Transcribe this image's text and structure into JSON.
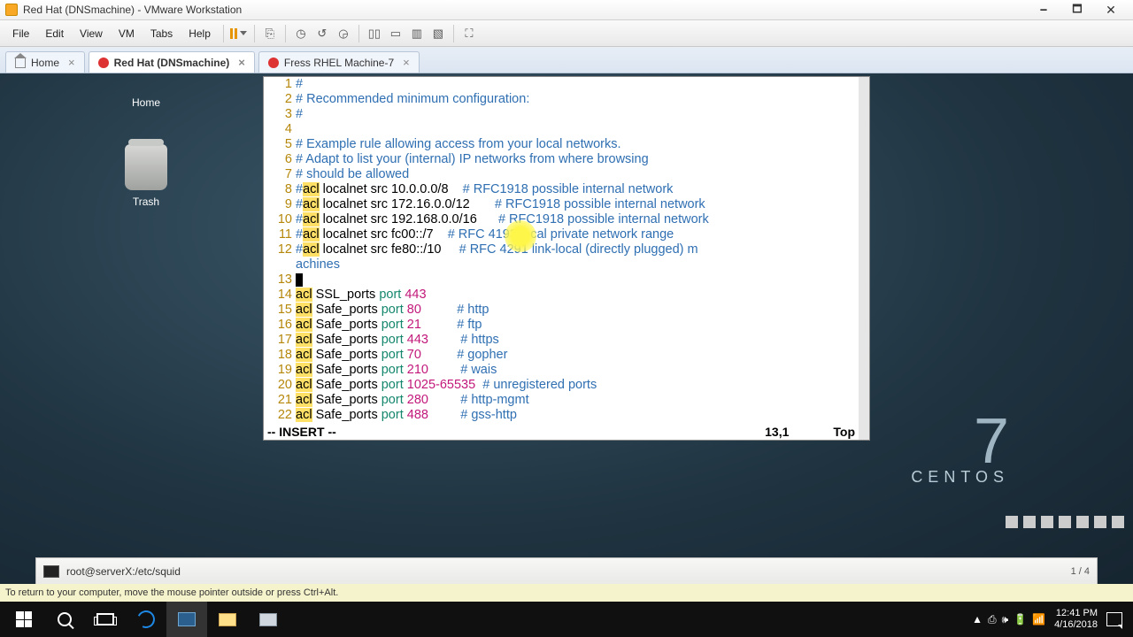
{
  "window": {
    "title": "Red Hat (DNSmachine) - VMware Workstation",
    "minimize": "🗕",
    "maximize": "🗖",
    "close": "✕"
  },
  "menu": {
    "file": "File",
    "edit": "Edit",
    "view": "View",
    "vm": "VM",
    "tabs": "Tabs",
    "help": "Help"
  },
  "tabs": {
    "home": "Home",
    "active": "Red Hat (DNSmachine)",
    "other": "Fress RHEL Machine-7"
  },
  "desktop": {
    "home": "Home",
    "trash": "Trash"
  },
  "centos": {
    "seven": "7",
    "label": "CENTOS"
  },
  "gnomebar": {
    "title": "root@serverX:/etc/squid",
    "pager": "1 / 4"
  },
  "hint": "To return to your computer, move the mouse pointer outside or press Ctrl+Alt.",
  "clock": {
    "time": "12:41 PM",
    "date": "4/16/2018"
  },
  "editor": {
    "mode": "-- INSERT --",
    "pos": "13,1",
    "loc": "Top",
    "lines": [
      {
        "n": "1",
        "text": [
          {
            "t": "#",
            "c": "c-comment"
          }
        ]
      },
      {
        "n": "2",
        "text": [
          {
            "t": "# Recommended minimum configuration:",
            "c": "c-comment"
          }
        ]
      },
      {
        "n": "3",
        "text": [
          {
            "t": "#",
            "c": "c-comment"
          }
        ]
      },
      {
        "n": "4",
        "text": [
          {
            "t": "",
            "c": ""
          }
        ]
      },
      {
        "n": "5",
        "text": [
          {
            "t": "# Example rule allowing access from your local networks.",
            "c": "c-comment"
          }
        ]
      },
      {
        "n": "6",
        "text": [
          {
            "t": "# Adapt to list your (internal) IP networks from where browsing",
            "c": "c-comment"
          }
        ]
      },
      {
        "n": "7",
        "text": [
          {
            "t": "# should be allowed",
            "c": "c-comment"
          }
        ]
      },
      {
        "n": "8",
        "text": [
          {
            "t": "#",
            "c": "c-comment"
          },
          {
            "t": "acl",
            "c": "c-acl"
          },
          {
            "t": " localnet src 10.0.0.0/8    ",
            "c": ""
          },
          {
            "t": "# RFC1918 possible internal network",
            "c": "c-comment"
          }
        ]
      },
      {
        "n": "9",
        "text": [
          {
            "t": "#",
            "c": "c-comment"
          },
          {
            "t": "acl",
            "c": "c-acl"
          },
          {
            "t": " localnet src 172.16.0.0/12       ",
            "c": ""
          },
          {
            "t": "# RFC1918 possible internal network",
            "c": "c-comment"
          }
        ]
      },
      {
        "n": "10",
        "text": [
          {
            "t": "#",
            "c": "c-comment"
          },
          {
            "t": "acl",
            "c": "c-acl"
          },
          {
            "t": " localnet src 192.168.0.0/16      ",
            "c": ""
          },
          {
            "t": "# RFC1918 possible internal network",
            "c": "c-comment"
          }
        ]
      },
      {
        "n": "11",
        "text": [
          {
            "t": "#",
            "c": "c-comment"
          },
          {
            "t": "acl",
            "c": "c-acl"
          },
          {
            "t": " localnet src fc00::/7    ",
            "c": ""
          },
          {
            "t": "# RFC 4193 local private network range",
            "c": "c-comment"
          }
        ]
      },
      {
        "n": "12",
        "text": [
          {
            "t": "#",
            "c": "c-comment"
          },
          {
            "t": "acl",
            "c": "c-acl"
          },
          {
            "t": " localnet src fe80::/10     ",
            "c": ""
          },
          {
            "t": "# RFC 4291 link-local (directly plugged) m",
            "c": "c-comment"
          }
        ]
      },
      {
        "n": "",
        "text": [
          {
            "t": "achines",
            "c": "c-comment"
          }
        ],
        "cont": true
      },
      {
        "n": "13",
        "text": [],
        "cursor": true
      },
      {
        "n": "14",
        "text": [
          {
            "t": "acl",
            "c": "c-acl"
          },
          {
            "t": " SSL_ports ",
            "c": ""
          },
          {
            "t": "port",
            "c": "c-port"
          },
          {
            "t": " ",
            "c": ""
          },
          {
            "t": "443",
            "c": "c-num"
          }
        ]
      },
      {
        "n": "15",
        "text": [
          {
            "t": "acl",
            "c": "c-acl"
          },
          {
            "t": " Safe_ports ",
            "c": ""
          },
          {
            "t": "port",
            "c": "c-port"
          },
          {
            "t": " ",
            "c": ""
          },
          {
            "t": "80",
            "c": "c-num"
          },
          {
            "t": "          ",
            "c": ""
          },
          {
            "t": "# http",
            "c": "c-comment"
          }
        ]
      },
      {
        "n": "16",
        "text": [
          {
            "t": "acl",
            "c": "c-acl"
          },
          {
            "t": " Safe_ports ",
            "c": ""
          },
          {
            "t": "port",
            "c": "c-port"
          },
          {
            "t": " ",
            "c": ""
          },
          {
            "t": "21",
            "c": "c-num"
          },
          {
            "t": "          ",
            "c": ""
          },
          {
            "t": "# ftp",
            "c": "c-comment"
          }
        ]
      },
      {
        "n": "17",
        "text": [
          {
            "t": "acl",
            "c": "c-acl"
          },
          {
            "t": " Safe_ports ",
            "c": ""
          },
          {
            "t": "port",
            "c": "c-port"
          },
          {
            "t": " ",
            "c": ""
          },
          {
            "t": "443",
            "c": "c-num"
          },
          {
            "t": "         ",
            "c": ""
          },
          {
            "t": "# https",
            "c": "c-comment"
          }
        ]
      },
      {
        "n": "18",
        "text": [
          {
            "t": "acl",
            "c": "c-acl"
          },
          {
            "t": " Safe_ports ",
            "c": ""
          },
          {
            "t": "port",
            "c": "c-port"
          },
          {
            "t": " ",
            "c": ""
          },
          {
            "t": "70",
            "c": "c-num"
          },
          {
            "t": "          ",
            "c": ""
          },
          {
            "t": "# gopher",
            "c": "c-comment"
          }
        ]
      },
      {
        "n": "19",
        "text": [
          {
            "t": "acl",
            "c": "c-acl"
          },
          {
            "t": " Safe_ports ",
            "c": ""
          },
          {
            "t": "port",
            "c": "c-port"
          },
          {
            "t": " ",
            "c": ""
          },
          {
            "t": "210",
            "c": "c-num"
          },
          {
            "t": "         ",
            "c": ""
          },
          {
            "t": "# wais",
            "c": "c-comment"
          }
        ]
      },
      {
        "n": "20",
        "text": [
          {
            "t": "acl",
            "c": "c-acl"
          },
          {
            "t": " Safe_ports ",
            "c": ""
          },
          {
            "t": "port",
            "c": "c-port"
          },
          {
            "t": " ",
            "c": ""
          },
          {
            "t": "1025-65535",
            "c": "c-num"
          },
          {
            "t": "  ",
            "c": ""
          },
          {
            "t": "# unregistered ports",
            "c": "c-comment"
          }
        ]
      },
      {
        "n": "21",
        "text": [
          {
            "t": "acl",
            "c": "c-acl"
          },
          {
            "t": " Safe_ports ",
            "c": ""
          },
          {
            "t": "port",
            "c": "c-port"
          },
          {
            "t": " ",
            "c": ""
          },
          {
            "t": "280",
            "c": "c-num"
          },
          {
            "t": "         ",
            "c": ""
          },
          {
            "t": "# http-mgmt",
            "c": "c-comment"
          }
        ]
      },
      {
        "n": "22",
        "text": [
          {
            "t": "acl",
            "c": "c-acl"
          },
          {
            "t": " Safe_ports ",
            "c": ""
          },
          {
            "t": "port",
            "c": "c-port"
          },
          {
            "t": " ",
            "c": ""
          },
          {
            "t": "488",
            "c": "c-num"
          },
          {
            "t": "         ",
            "c": ""
          },
          {
            "t": "# gss-http",
            "c": "c-comment"
          }
        ]
      }
    ]
  },
  "tray_icons": [
    "▲",
    "⎙",
    "🕪",
    "🔋",
    "📶"
  ]
}
